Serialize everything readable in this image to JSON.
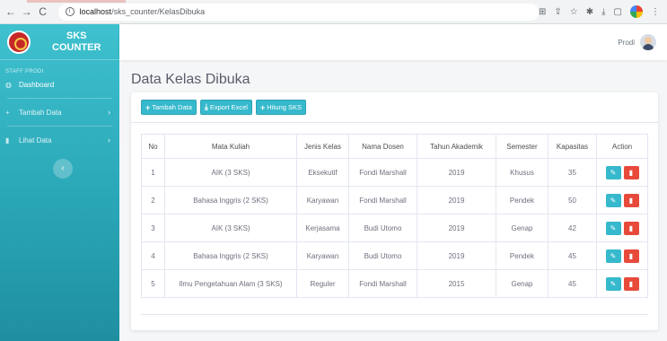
{
  "browser": {
    "url_host": "localhost",
    "url_path": "/sks_counter/KelasDibuka"
  },
  "sidebar": {
    "brand_line1": "SKS",
    "brand_line2": "COUNTER",
    "heading": "STAFF PRODI",
    "items": [
      {
        "label": "Dashboard",
        "icon": "dashboard-icon"
      },
      {
        "label": "Tambah Data",
        "icon": "plus-icon"
      },
      {
        "label": "Lihat Data",
        "icon": "document-icon"
      }
    ]
  },
  "topbar": {
    "user": "Prodi"
  },
  "page": {
    "title": "Data Kelas Dibuka"
  },
  "toolbar": {
    "add_label": "Tambah Data",
    "export_label": "Export Excel",
    "sks_label": "Hitung SKS"
  },
  "table": {
    "headers": [
      "No",
      "Mata Kuliah",
      "Jenis Kelas",
      "Nama Dosen",
      "Tahun Akademik",
      "Semester",
      "Kapasitas",
      "Action"
    ],
    "rows": [
      [
        "1",
        "AIK (3 SKS)",
        "Eksekutif",
        "Fondi Marshall",
        "2019",
        "Khusus",
        "35"
      ],
      [
        "2",
        "Bahasa Inggris (2 SKS)",
        "Karyawan",
        "Fondi Marshall",
        "2019",
        "Pendek",
        "50"
      ],
      [
        "3",
        "AIK (3 SKS)",
        "Kerjasama",
        "Budi Utomo",
        "2019",
        "Genap",
        "42"
      ],
      [
        "4",
        "Bahasa Inggris (2 SKS)",
        "Karyawan",
        "Budi Utomo",
        "2019",
        "Pendek",
        "45"
      ],
      [
        "5",
        "Ilmu Pengetahuan Alam (3 SKS)",
        "Reguler",
        "Fondi Marshall",
        "2015",
        "Genap",
        "45"
      ]
    ]
  },
  "colors": {
    "accent": "#36b9cc",
    "danger": "#e74a3b",
    "sidebar": "#2aa7b7"
  }
}
